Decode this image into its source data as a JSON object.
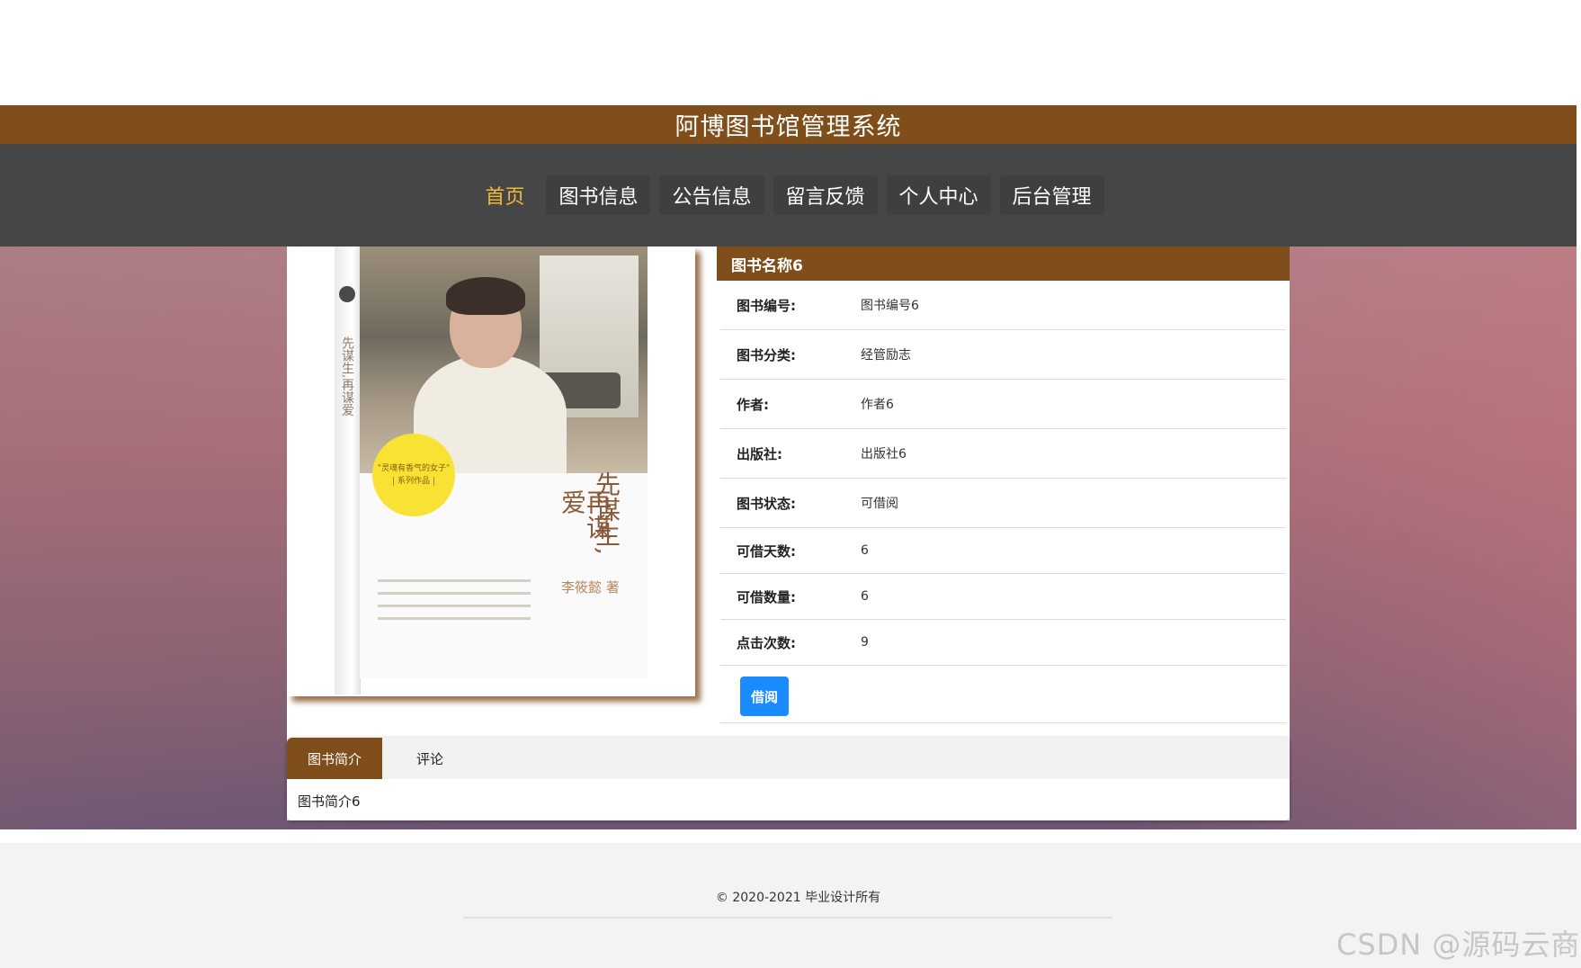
{
  "site": {
    "title": "阿博图书馆管理系统"
  },
  "nav": {
    "items": [
      {
        "label": "首页",
        "active": true
      },
      {
        "label": "图书信息",
        "active": false
      },
      {
        "label": "公告信息",
        "active": false
      },
      {
        "label": "留言反馈",
        "active": false
      },
      {
        "label": "个人中心",
        "active": false
      },
      {
        "label": "后台管理",
        "active": false
      }
    ]
  },
  "cover": {
    "title_col1": "先谋生,",
    "title_col2": "再谋爱",
    "author": "李筱懿 著",
    "sticker_line1": "\"灵魂有香气的女子\"",
    "sticker_line2": "| 系列作品 |",
    "spine_text": "先谋生,再谋爱"
  },
  "book": {
    "name": "图书名称6",
    "fields": [
      {
        "label": "图书编号:",
        "value": "图书编号6"
      },
      {
        "label": "图书分类:",
        "value": "经管励志"
      },
      {
        "label": "作者:",
        "value": "作者6"
      },
      {
        "label": "出版社:",
        "value": "出版社6"
      },
      {
        "label": "图书状态:",
        "value": "可借阅"
      },
      {
        "label": "可借天数:",
        "value": "6"
      },
      {
        "label": "可借数量:",
        "value": "6"
      },
      {
        "label": "点击次数:",
        "value": "9"
      }
    ],
    "borrow_label": "借阅"
  },
  "tabs": {
    "items": [
      {
        "label": "图书简介",
        "active": true
      },
      {
        "label": "评论",
        "active": false
      }
    ],
    "content": "图书简介6"
  },
  "footer": {
    "copyright": "© 2020-2021 毕业设计所有"
  },
  "watermark": "CSDN @源码云商",
  "colors": {
    "brand_brown": "#7f4e1a",
    "nav_bg": "#464646",
    "active_nav": "#f0b93a",
    "button_blue": "#1a8cff"
  }
}
